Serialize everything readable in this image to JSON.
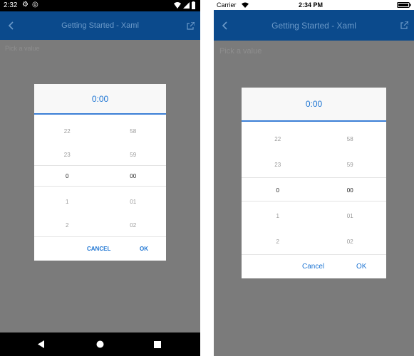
{
  "android": {
    "status": {
      "time": "2:32"
    },
    "title": "Getting Started - Xaml",
    "placeholder": "Pick a value",
    "dialog": {
      "header": "0:00",
      "hours": [
        "22",
        "23",
        "0",
        "1",
        "2"
      ],
      "minutes": [
        "58",
        "59",
        "00",
        "01",
        "02"
      ],
      "cancel": "CANCEL",
      "ok": "OK"
    }
  },
  "ios": {
    "status": {
      "carrier": "Carrier",
      "time": "2:34 PM"
    },
    "title": "Getting Started - Xaml",
    "placeholder": "Pick a value",
    "dialog": {
      "header": "0:00",
      "hours": [
        "22",
        "23",
        "0",
        "1",
        "2"
      ],
      "minutes": [
        "58",
        "59",
        "00",
        "01",
        "02"
      ],
      "cancel": "Cancel",
      "ok": "OK"
    }
  },
  "colors": {
    "accent": "#1e75d3",
    "titlebar": "#0b4a8c",
    "overlay": "#7b7b7b"
  }
}
